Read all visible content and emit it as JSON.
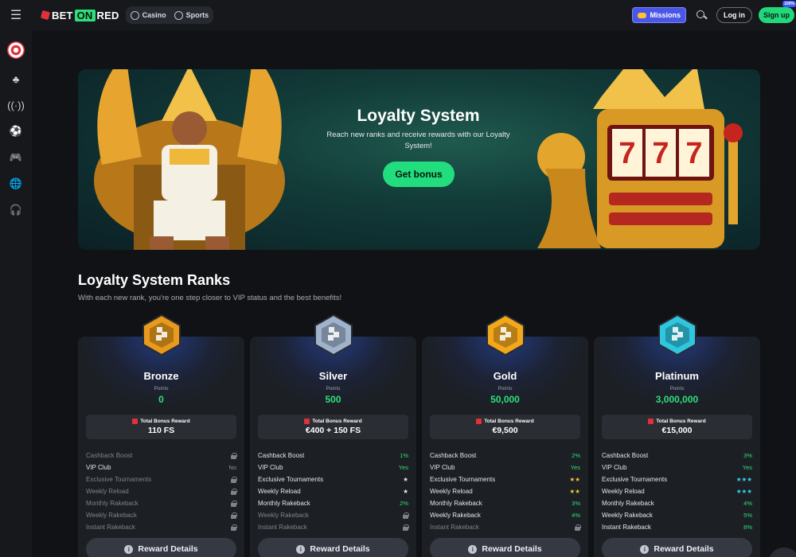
{
  "topbar": {
    "logo": {
      "bet": "BET",
      "on": "ON",
      "red": "RED"
    },
    "switch": [
      {
        "label": "Casino",
        "icon": "cherries-icon"
      },
      {
        "label": "Sports",
        "icon": "soccer-ball-icon"
      }
    ],
    "missions_label": "Missions",
    "login_label": "Log in",
    "signup_label": "Sign up",
    "signup_badge": "100%"
  },
  "sidebar": [
    "target-icon",
    "cherries-icon",
    "live-broadcast-icon",
    "soccer-ball-icon",
    "gamepad-icon",
    "globe-icon",
    "headset-icon"
  ],
  "hero": {
    "title": "Loyalty System",
    "subtitle": "Reach new ranks and receive rewards with our Loyalty System!",
    "cta": "Get bonus",
    "slot_digits": "777"
  },
  "ranks": {
    "title": "Loyalty System Ranks",
    "subtitle": "With each new rank, you're one step closer to VIP status and the best benefits!",
    "points_label": "Points",
    "bonus_label": "Total Bonus Reward",
    "details_label": "Reward Details",
    "benefit_names": [
      "Cashback Boost",
      "VIP Club",
      "Exclusive Tournaments",
      "Weekly Reload",
      "Monthly Rakeback",
      "Weekly Rakeback",
      "Instant Rakeback"
    ],
    "cards": [
      {
        "name": "Bronze",
        "points": "0",
        "bonus": "110 FS",
        "badge_color": "#e89a1c",
        "benefits": [
          {
            "value": "lock",
            "type": "lock"
          },
          {
            "value": "No",
            "type": "gray"
          },
          {
            "value": "lock",
            "type": "lock"
          },
          {
            "value": "lock",
            "type": "lock"
          },
          {
            "value": "lock",
            "type": "lock"
          },
          {
            "value": "lock",
            "type": "lock"
          },
          {
            "value": "lock",
            "type": "lock"
          }
        ]
      },
      {
        "name": "Silver",
        "points": "500",
        "bonus": "€400 + 150 FS",
        "badge_color": "#9fb3cc",
        "benefits": [
          {
            "value": "1%",
            "type": "green"
          },
          {
            "value": "Yes",
            "type": "green"
          },
          {
            "value": "★",
            "type": "white"
          },
          {
            "value": "★",
            "type": "white"
          },
          {
            "value": "2%",
            "type": "green"
          },
          {
            "value": "lock",
            "type": "lock"
          },
          {
            "value": "lock",
            "type": "lock"
          }
        ]
      },
      {
        "name": "Gold",
        "points": "50,000",
        "bonus": "€9,500",
        "badge_color": "#f3a81c",
        "benefits": [
          {
            "value": "2%",
            "type": "green"
          },
          {
            "value": "Yes",
            "type": "green"
          },
          {
            "value": "★★",
            "type": "gold"
          },
          {
            "value": "★★",
            "type": "gold"
          },
          {
            "value": "3%",
            "type": "green"
          },
          {
            "value": "4%",
            "type": "green"
          },
          {
            "value": "lock",
            "type": "lock"
          }
        ]
      },
      {
        "name": "Platinum",
        "points": "3,000,000",
        "bonus": "€15,000",
        "badge_color": "#2fc6e0",
        "benefits": [
          {
            "value": "3%",
            "type": "green"
          },
          {
            "value": "Yes",
            "type": "green"
          },
          {
            "value": "★★★",
            "type": "cyan"
          },
          {
            "value": "★★★",
            "type": "cyan"
          },
          {
            "value": "4%",
            "type": "green"
          },
          {
            "value": "5%",
            "type": "green"
          },
          {
            "value": "8%",
            "type": "green"
          }
        ]
      }
    ]
  },
  "colors": {
    "accent_green": "#22dd7d",
    "missions_blue": "#4a56e6",
    "background": "#101215",
    "card": "#1c1f24"
  }
}
